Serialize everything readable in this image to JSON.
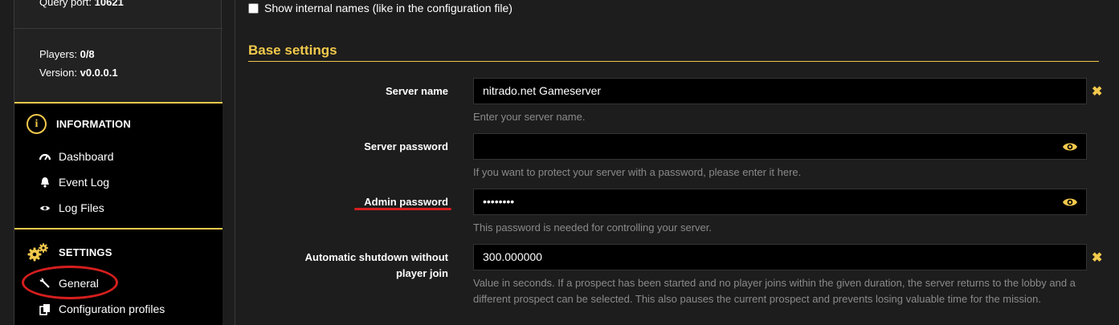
{
  "sidebar": {
    "query_port_label": "Query port:",
    "query_port_value": "10621",
    "players_label": "Players:",
    "players_value": "0/8",
    "version_label": "Version:",
    "version_value": "v0.0.0.1",
    "information": {
      "title": "INFORMATION",
      "icon": "info-icon",
      "items": [
        {
          "label": "Dashboard",
          "icon": "gauge-icon"
        },
        {
          "label": "Event Log",
          "icon": "bell-icon"
        },
        {
          "label": "Log Files",
          "icon": "eye-icon"
        }
      ]
    },
    "settings": {
      "title": "SETTINGS",
      "icon": "gears-icon",
      "items": [
        {
          "label": "General",
          "icon": "wrench-icon"
        },
        {
          "label": "Configuration profiles",
          "icon": "copy-icon"
        }
      ]
    }
  },
  "main": {
    "show_internal_names": "Show internal names (like in the configuration file)",
    "base_settings_title": "Base settings",
    "fields": [
      {
        "label": "Server name",
        "value": "nitrado.net Gameserver",
        "help": "Enter your server name."
      },
      {
        "label": "Server password",
        "value": "",
        "help": "If you want to protect your server with a password, please enter it here."
      },
      {
        "label": "Admin password",
        "value": "••••••••",
        "help": "This password is needed for controlling your server."
      },
      {
        "label_line1": "Automatic shutdown without",
        "label_line2": "player join",
        "value": "300.000000",
        "help": "Value in seconds. If a prospect has been started and no player joins within the given duration, the server returns to the lobby and a different prospect can be selected. This also pauses the current prospect and prevents losing valuable time for the mission."
      }
    ]
  },
  "colors": {
    "accent": "#f2c94c",
    "annotation": "#d61e1e"
  }
}
